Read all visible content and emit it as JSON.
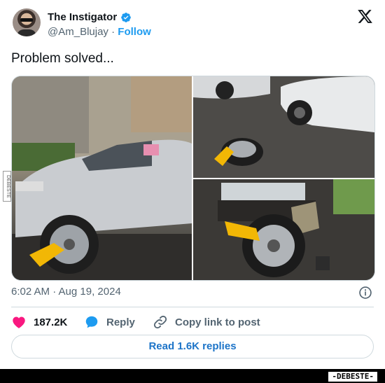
{
  "author": {
    "name": "The Instigator",
    "handle": "@Am_Blujay",
    "separator": "·",
    "follow_label": "Follow"
  },
  "tweet": {
    "text": "Problem solved...",
    "timestamp": "6:02 AM · Aug 19, 2024"
  },
  "actions": {
    "likes": "187.2K",
    "reply_label": "Reply",
    "copy_label": "Copy link to post"
  },
  "read_replies_label": "Read 1.6K replies",
  "watermark": "-DEBESTE-",
  "side_watermark": "DEBESTE",
  "colors": {
    "accent_blue": "#1d9bf0",
    "like_pink": "#f91880",
    "text_primary": "#0f1419",
    "text_secondary": "#536471"
  },
  "icons": {
    "verified": "verified-badge-icon",
    "logo": "x-logo-icon",
    "info": "info-icon",
    "like": "heart-icon",
    "reply": "speech-bubble-icon",
    "copy": "link-icon"
  }
}
